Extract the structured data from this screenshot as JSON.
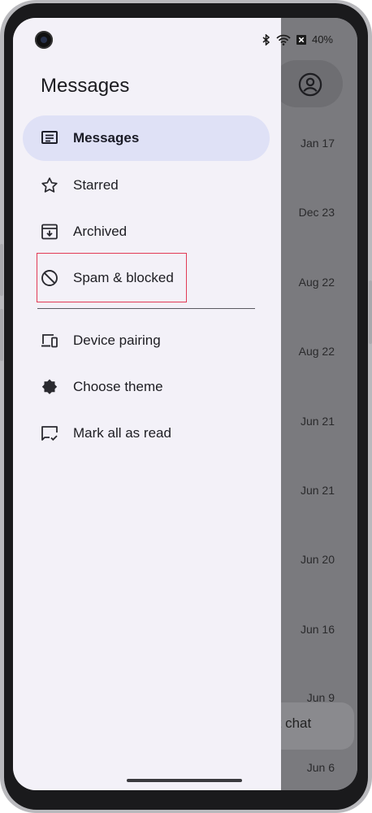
{
  "status": {
    "battery": "40%"
  },
  "drawer": {
    "title": "Messages",
    "items": [
      {
        "label": "Messages",
        "icon": "messages-icon",
        "active": true
      },
      {
        "label": "Starred",
        "icon": "star-icon"
      },
      {
        "label": "Archived",
        "icon": "archive-icon"
      },
      {
        "label": "Spam & blocked",
        "icon": "block-icon"
      },
      {
        "label": "Device pairing",
        "icon": "devices-icon"
      },
      {
        "label": "Choose theme",
        "icon": "theme-icon"
      },
      {
        "label": "Mark all as read",
        "icon": "mark-read-icon"
      }
    ]
  },
  "background": {
    "dates": [
      "Jan 17",
      "Dec 23",
      "Aug 22",
      "Aug 22",
      "Jun 21",
      "Jun 21",
      "Jun 20",
      "Jun 16",
      "Jun 9",
      "Jun 6"
    ],
    "fab_label": "rt chat"
  },
  "colors": {
    "active_pill": "#dfe1f6",
    "drawer_bg": "#f3f1f8",
    "highlight": "#e23a55",
    "scrim": "#7a7a7e"
  }
}
